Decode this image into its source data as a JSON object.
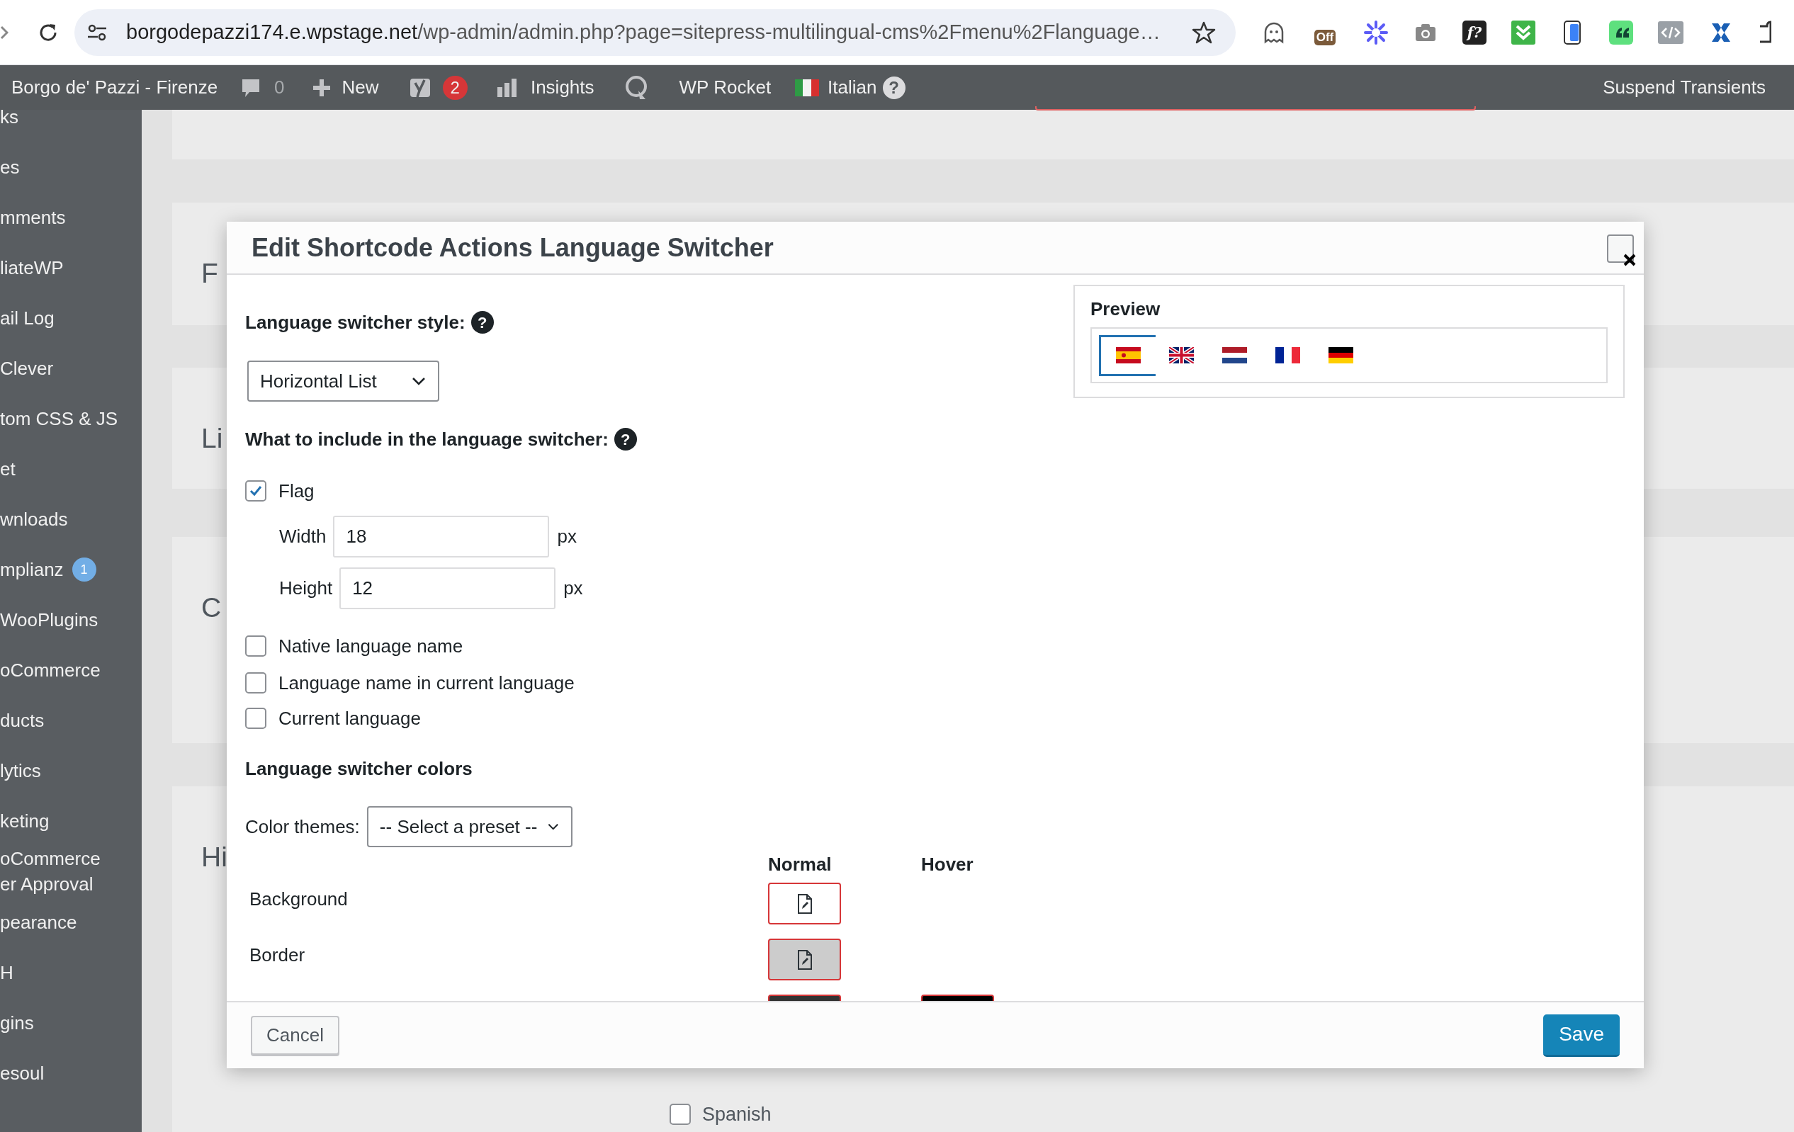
{
  "browser": {
    "url_host": "borgodepazzi174.e.wpstage.net",
    "url_path": "/wp-admin/admin.php?page=sitepress-multilingual-cms%2Fmenu%2Flanguage…",
    "extensions": [
      {
        "kind": "ghost"
      },
      {
        "kind": "badge",
        "label": "Off"
      },
      {
        "kind": "spark"
      },
      {
        "kind": "camera"
      },
      {
        "kind": "font",
        "label": "f?"
      },
      {
        "kind": "chevrons"
      },
      {
        "kind": "phone"
      },
      {
        "kind": "quote"
      },
      {
        "kind": "code"
      },
      {
        "kind": "cross"
      },
      {
        "kind": "puzzle"
      }
    ]
  },
  "admin_bar": {
    "site": "Borgo de' Pazzi - Firenze",
    "comments": "0",
    "new": "New",
    "yoast_count": "2",
    "insights": "Insights",
    "rocket": "WP Rocket",
    "language": "Italian",
    "language_help": "?",
    "suspend": "Suspend Transients"
  },
  "sidebar": {
    "items": [
      {
        "label": "ks"
      },
      {
        "label": "es"
      },
      {
        "label": "mments"
      },
      {
        "label": "liateWP"
      },
      {
        "label": "ail Log"
      },
      {
        "label": "Clever"
      },
      {
        "label": "tom CSS & JS"
      },
      {
        "label": "et"
      },
      {
        "label": "wnloads"
      },
      {
        "label": "mplianz",
        "badge": "1"
      },
      {
        "label": "WooPlugins"
      },
      {
        "label": "oCommerce"
      },
      {
        "label": "ducts"
      },
      {
        "label": "lytics"
      },
      {
        "label": "keting"
      },
      {
        "label": "oCommerce\ner Approval"
      },
      {
        "label": "pearance"
      },
      {
        "label": "H"
      },
      {
        "label": "gins"
      },
      {
        "label": "esoul"
      }
    ]
  },
  "background_page": {
    "cards": [
      {
        "heading": "F"
      },
      {
        "heading": "Li"
      },
      {
        "heading": "C"
      },
      {
        "heading": "Hi"
      }
    ],
    "languages": [
      {
        "label": "Spanish",
        "checked": false
      }
    ]
  },
  "dialog": {
    "title": "Edit Shortcode Actions Language Switcher",
    "style_label": "Language switcher style:",
    "style_help": "?",
    "style_select": "Horizontal List",
    "include_label": "What to include in the language switcher:",
    "include_help": "?",
    "options": [
      {
        "label": "Flag",
        "checked": true,
        "size_fields": [
          {
            "label": "Width",
            "value": "18",
            "unit": "px"
          },
          {
            "label": "Height",
            "value": "12",
            "unit": "px"
          }
        ]
      },
      {
        "label": "Native language name",
        "checked": false
      },
      {
        "label": "Language name in current language",
        "checked": false
      },
      {
        "label": "Current language",
        "checked": false
      }
    ],
    "colors_heading": "Language switcher colors",
    "themes_label": "Color themes:",
    "themes_select": "-- Select a preset --",
    "color_columns": [
      "Normal",
      "Hover"
    ],
    "color_rows": [
      {
        "label": "Background",
        "normal": {
          "color": "#ffffff",
          "kind": "edit"
        }
      },
      {
        "label": "Border",
        "normal": {
          "color": "#cccccc",
          "kind": "edit"
        }
      },
      {
        "normal": {
          "color": "#333333"
        },
        "hover": {
          "color": "#000000"
        }
      }
    ],
    "preview": {
      "heading": "Preview",
      "flags": [
        {
          "kind": "es",
          "selected": true
        },
        {
          "kind": "gb",
          "selected": false
        },
        {
          "kind": "nl",
          "selected": false
        },
        {
          "kind": "fr",
          "selected": false
        },
        {
          "kind": "de",
          "selected": false
        }
      ]
    },
    "cancel": "Cancel",
    "save": "Save"
  }
}
